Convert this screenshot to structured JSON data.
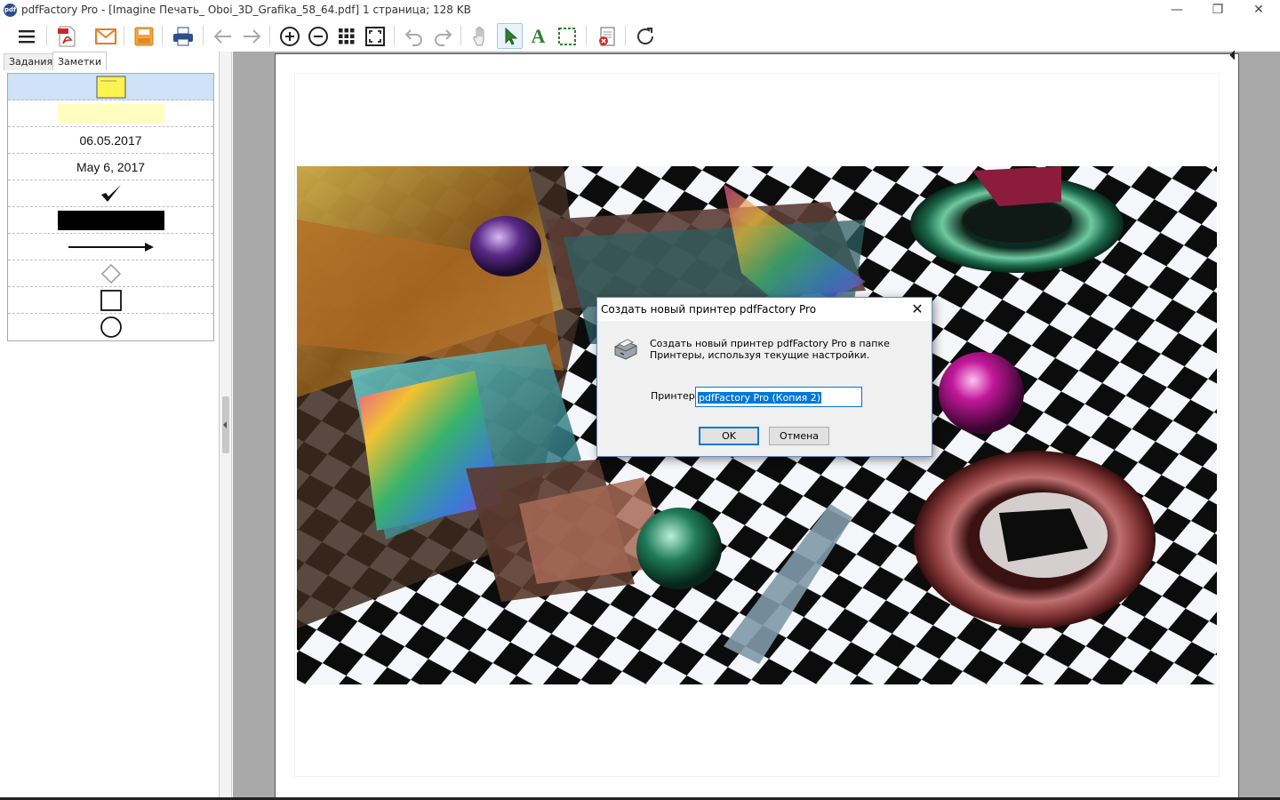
{
  "app": {
    "logo": "pdf",
    "title": "pdfFactory Pro - [Imagine Печать_ Oboi_3D_Grafika_58_64.pdf] 1 страница; 128 KB"
  },
  "window_controls": {
    "minimize": "—",
    "restore": "❐",
    "close": "✕"
  },
  "toolbar": {
    "icons": [
      "menu-icon",
      "pdf-icon",
      "email-icon",
      "save-icon",
      "print-icon",
      "back-icon",
      "forward-icon",
      "zoom-in-icon",
      "zoom-out-icon",
      "grid-icon",
      "fit-page-icon",
      "undo-icon",
      "redo-icon",
      "hand-icon",
      "select-arrow-icon",
      "text-icon",
      "marquee-icon",
      "delete-page-icon",
      "refresh-icon"
    ],
    "selected": "select-arrow-icon",
    "text_tool_glyph": "A"
  },
  "left_panel": {
    "tabs": [
      {
        "label": "Задания",
        "active": false
      },
      {
        "label": "Заметки",
        "active": true
      }
    ],
    "notes": [
      {
        "type": "sticky-note-icon"
      },
      {
        "type": "highlight-swatch",
        "color": "#fffec0"
      },
      {
        "type": "date",
        "text": "06.05.2017"
      },
      {
        "type": "date",
        "text": "May 6, 2017"
      },
      {
        "type": "checkmark-icon"
      },
      {
        "type": "redaction-bar",
        "color": "#000000"
      },
      {
        "type": "arrow-line-icon"
      },
      {
        "type": "diamond-icon"
      },
      {
        "type": "square-icon"
      },
      {
        "type": "circle-icon"
      }
    ]
  },
  "dialog": {
    "title": "Создать новый принтер pdfFactory Pro",
    "close": "✕",
    "icon": "printer-icon",
    "message": "Создать новый принтер pdfFactory Pro в папке Принтеры, используя текущие настройки.",
    "printer_label": "Принтер:",
    "printer_value": "pdfFactory Pro (Копия 2)",
    "ok_label": "OK",
    "cancel_label": "Отмена"
  },
  "colors": {
    "accent": "#0078d7",
    "selection_row": "#cfe2f7",
    "doc_background": "#a9a9a9"
  }
}
